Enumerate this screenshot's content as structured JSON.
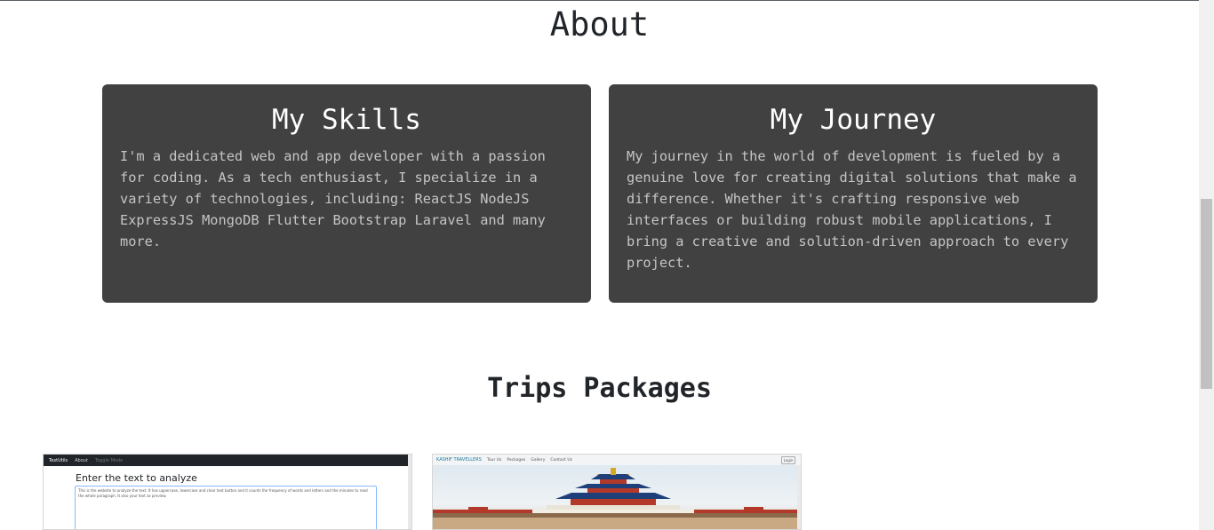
{
  "about": {
    "title": "About",
    "skills": {
      "title": "My Skills",
      "text": "I'm a dedicated web and app developer with a passion for coding. As a tech enthusiast, I specialize in a variety of technologies, including: ReactJS NodeJS ExpressJS MongoDB Flutter Bootstrap Laravel and many more."
    },
    "journey": {
      "title": "My Journey",
      "text": "My journey in the world of development is fueled by a genuine love for creating digital solutions that make a difference. Whether it's crafting responsive web interfaces or building robust mobile applications, I bring a creative and solution-driven approach to every project."
    }
  },
  "trips": {
    "title": "Trips Packages",
    "thumb_one": {
      "nav_brand": "TextUtils",
      "nav_about": "About",
      "nav_mode": "Toggle Mode",
      "heading": "Enter the text to analyze",
      "textarea": "This is the website to analyze the text. It has uppercase, lowercase and clear text button and it counts the frequency of words and letters and the minutes to read the whole paragraph. It also your text as preview."
    },
    "thumb_two": {
      "nav_brand": "KASHIF TRAVELLERS",
      "nav_items": [
        "Tour Us",
        "Packages",
        "Gallery",
        "Contact Us"
      ],
      "nav_button": "Login"
    }
  },
  "colors": {
    "card_bg": "#414141",
    "card_text": "#c5c5c5",
    "card_title": "#ffffff"
  }
}
